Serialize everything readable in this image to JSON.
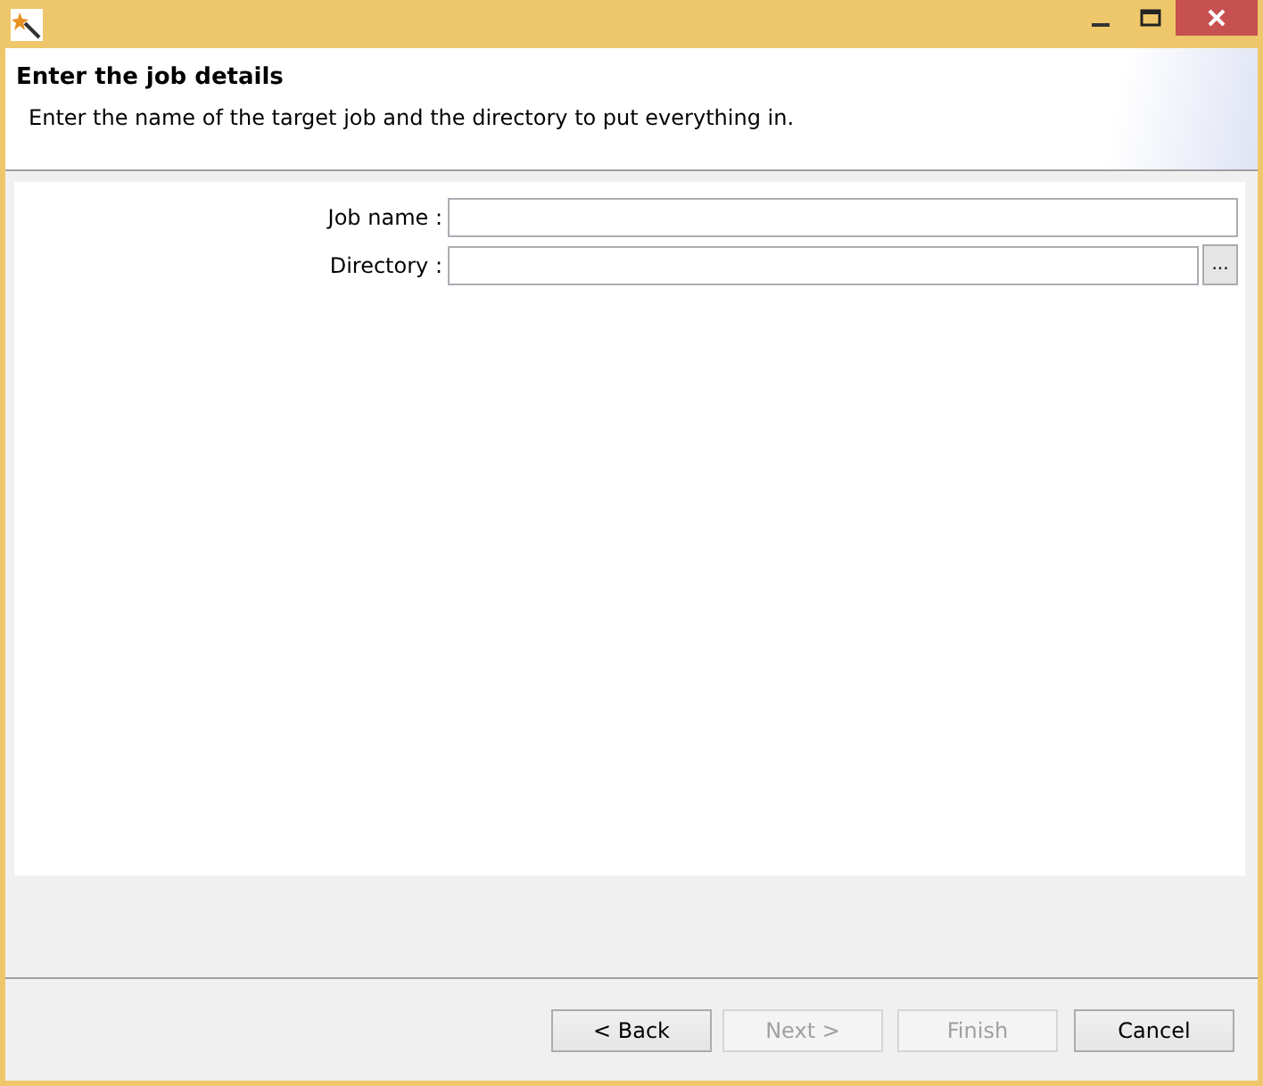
{
  "header": {
    "title": "Enter the job details",
    "description": "Enter the name of the target job and the directory to put everything in."
  },
  "fields": [
    {
      "kind": "text",
      "label": "Job name :"
    },
    {
      "kind": "browse",
      "label": "Directory :",
      "browse_label": "..."
    }
  ],
  "buttons": [
    {
      "label": "< Back",
      "disabled": false
    },
    {
      "label": "Next >",
      "disabled": true
    },
    {
      "label": "Finish",
      "disabled": true
    },
    {
      "label": "Cancel",
      "disabled": false
    }
  ]
}
